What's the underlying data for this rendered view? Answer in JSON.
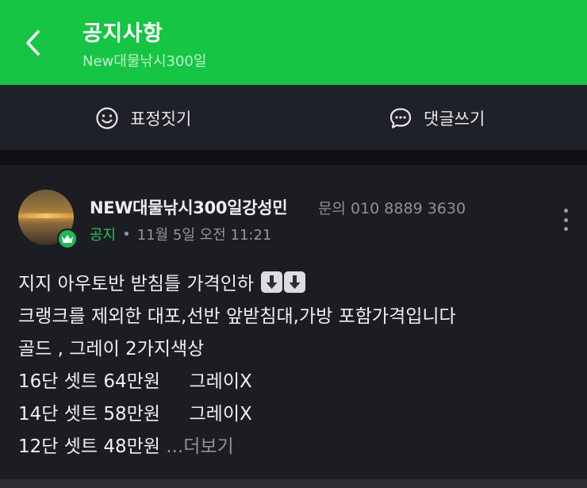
{
  "header": {
    "title": "공지사항",
    "subtitle": "New대물낚시300일",
    "background_color": "#16c543",
    "back_icon": "chevron-left-icon"
  },
  "actions": {
    "emoji_label": "표정짓기",
    "emoji_icon": "smile-icon",
    "comment_label": "댓글쓰기",
    "comment_icon": "chat-bubble-icon"
  },
  "post": {
    "author": "NEW대물낚시300일강성민",
    "contact": "문의 010 8889 3630",
    "tag": "공지",
    "separator": "•",
    "timestamp": "11월 5일 오전 11:21",
    "more_icon": "more-vertical-icon",
    "badge_icon": "crown-icon",
    "lines": {
      "l1": "지지 아우토반 받침틀 가격인하",
      "l2": "크랭크를 제외한 대포,선반 앞받침대,가방 포함가격입니다",
      "l3": "골드 , 그레이 2가지색상",
      "l4": "16단 셋트 64만원     그레이X",
      "l5": "14단 셋트 58만원     그레이X",
      "l6": "12단 셋트 48만원 "
    },
    "down_arrow_emoji": "⬇️⬇️",
    "more_link": "...더보기",
    "accent_color": "#22c55a"
  }
}
